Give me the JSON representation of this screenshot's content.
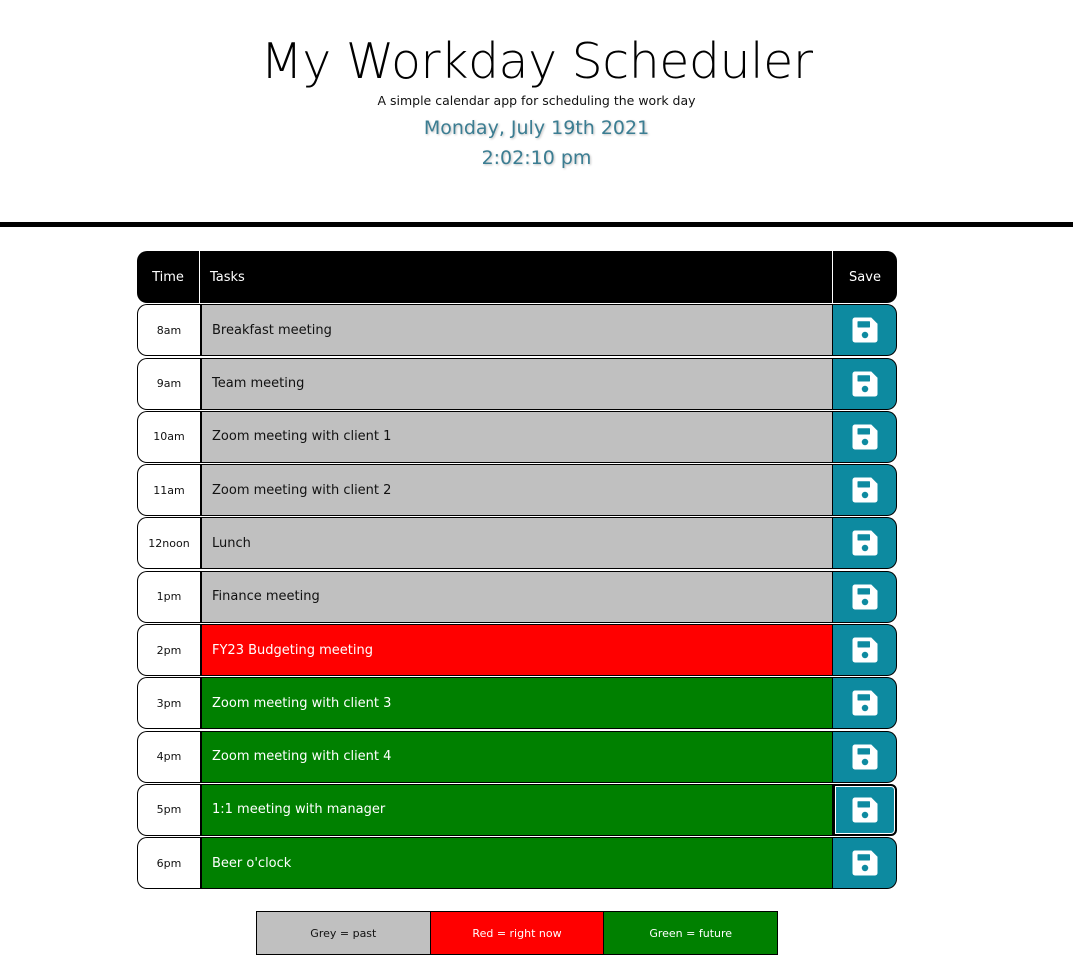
{
  "header": {
    "title": "My Workday Scheduler",
    "subtitle": "A simple calendar app for scheduling the work day",
    "current_date": "Monday, July 19th 2021",
    "current_time": "2:02:10 pm"
  },
  "table": {
    "columns": {
      "time": "Time",
      "tasks": "Tasks",
      "save": "Save"
    },
    "rows": [
      {
        "hour": "8am",
        "hour_line2": "",
        "task": "Breakfast meeting",
        "status": "past",
        "save_icon": "floppy-disk-icon"
      },
      {
        "hour": "9am",
        "hour_line2": "",
        "task": "Team meeting",
        "status": "past",
        "save_icon": "floppy-disk-icon"
      },
      {
        "hour": "10am",
        "hour_line2": "",
        "task": "Zoom meeting with client 1",
        "status": "past",
        "save_icon": "floppy-disk-icon"
      },
      {
        "hour": "11am",
        "hour_line2": "",
        "task": "Zoom meeting with client 2",
        "status": "past",
        "save_icon": "floppy-disk-icon"
      },
      {
        "hour": "12",
        "hour_line2": "noon",
        "task": "Lunch",
        "status": "past",
        "save_icon": "floppy-disk-icon"
      },
      {
        "hour": "1pm",
        "hour_line2": "",
        "task": "Finance meeting",
        "status": "past",
        "save_icon": "floppy-disk-icon"
      },
      {
        "hour": "2pm",
        "hour_line2": "",
        "task": "FY23 Budgeting meeting",
        "status": "present",
        "save_icon": "floppy-disk-icon"
      },
      {
        "hour": "3pm",
        "hour_line2": "",
        "task": "Zoom meeting with client 3",
        "status": "future",
        "save_icon": "floppy-disk-icon"
      },
      {
        "hour": "4pm",
        "hour_line2": "",
        "task": "Zoom meeting with client 4",
        "status": "future",
        "save_icon": "floppy-disk-icon"
      },
      {
        "hour": "5pm",
        "hour_line2": "",
        "task": "1:1 meeting with manager",
        "status": "future",
        "save_icon": "floppy-disk-icon",
        "focused": true
      },
      {
        "hour": "6pm",
        "hour_line2": "",
        "task": "Beer o'clock",
        "status": "future",
        "save_icon": "floppy-disk-icon"
      }
    ]
  },
  "legend": {
    "past": "Grey = past",
    "present": "Red = right now",
    "future": "Green = future"
  },
  "colors": {
    "past": "#c0c0c0",
    "present": "#ff0000",
    "future": "#008000",
    "save_button": "#0d8aa0",
    "date_text": "#3b7d92"
  }
}
